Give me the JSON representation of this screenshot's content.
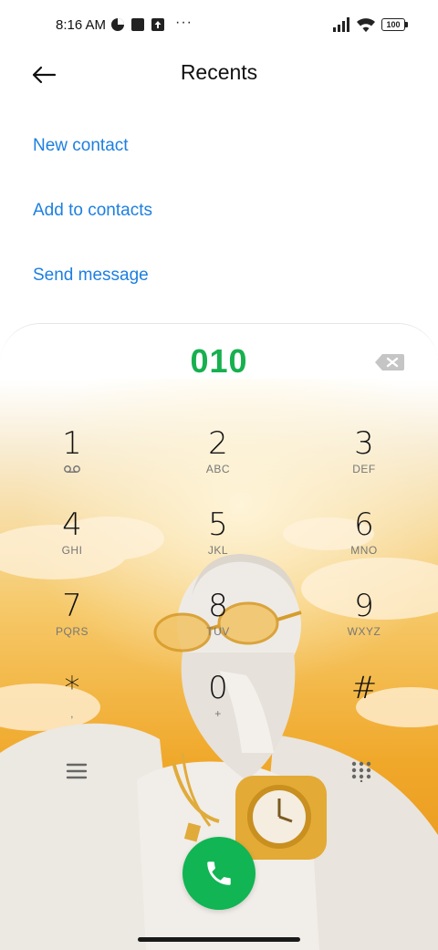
{
  "status_bar": {
    "time": "8:16 AM",
    "battery": "100",
    "more": "···"
  },
  "header": {
    "title": "Recents",
    "back_icon": "arrow-left-icon"
  },
  "options": [
    {
      "label": "New contact"
    },
    {
      "label": "Add to contacts"
    },
    {
      "label": "Send message"
    }
  ],
  "dialer": {
    "number": "010",
    "keys": [
      {
        "digit": "1",
        "letters": ""
      },
      {
        "digit": "2",
        "letters": "ABC"
      },
      {
        "digit": "3",
        "letters": "DEF"
      },
      {
        "digit": "4",
        "letters": "GHI"
      },
      {
        "digit": "5",
        "letters": "JKL"
      },
      {
        "digit": "6",
        "letters": "MNO"
      },
      {
        "digit": "7",
        "letters": "PQRS"
      },
      {
        "digit": "8",
        "letters": "TUV"
      },
      {
        "digit": "9",
        "letters": "WXYZ"
      },
      {
        "digit": "*",
        "letters": ","
      },
      {
        "digit": "0",
        "letters": "+"
      },
      {
        "digit": "#",
        "letters": ""
      }
    ],
    "accent_color": "#17b04f",
    "call_color": "#11b553"
  },
  "colors": {
    "link": "#1d7fe0"
  }
}
